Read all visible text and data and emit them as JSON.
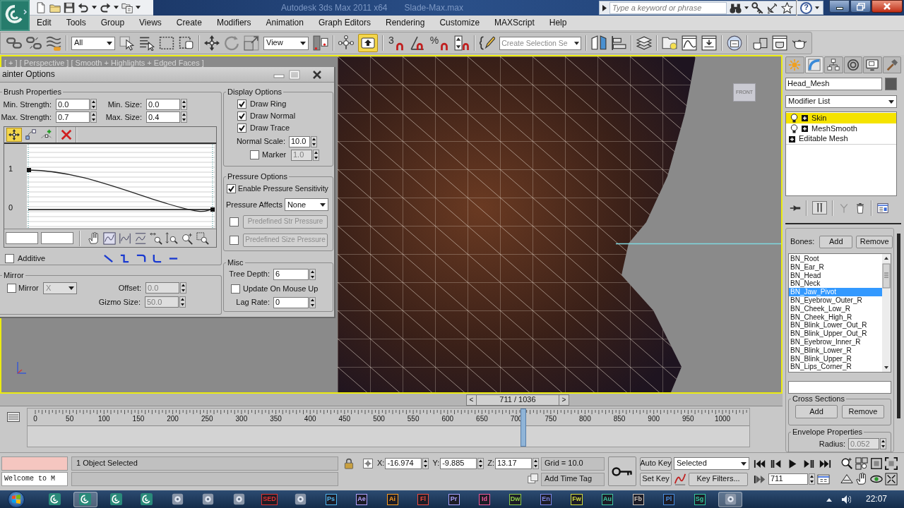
{
  "title_bar": {
    "app_title": "Autodesk 3ds Max 2011 x64",
    "file_name": "Slade-Max.max",
    "search": {
      "placeholder": "Type a keyword or phrase"
    },
    "help_label": "?"
  },
  "menu_bar": [
    "Edit",
    "Tools",
    "Group",
    "Views",
    "Create",
    "Modifiers",
    "Animation",
    "Graph Editors",
    "Rendering",
    "Customize",
    "MAXScript",
    "Help"
  ],
  "main_toolbar": [
    {
      "kind": "link",
      "selected": false
    },
    {
      "kind": "unlink",
      "selected": false
    },
    {
      "kind": "bind",
      "selected": false
    },
    {
      "kind": "dropdown",
      "value": "All"
    },
    {
      "kind": "select",
      "selected": false
    },
    {
      "kind": "select-by-name",
      "selected": false
    },
    {
      "kind": "region",
      "selected": false
    },
    {
      "kind": "crossing",
      "selected": false
    },
    {
      "kind": "move",
      "selected": false
    },
    {
      "kind": "rotate",
      "selected": false
    },
    {
      "kind": "scale",
      "selected": false
    },
    {
      "kind": "dropdown",
      "value": "View"
    },
    {
      "kind": "pivot",
      "selected": false
    },
    {
      "kind": "manipulate",
      "selected": false
    },
    {
      "kind": "override",
      "selected": true
    },
    {
      "kind": "snap",
      "label": "3",
      "selected": false
    },
    {
      "kind": "angle-snap",
      "selected": false
    },
    {
      "kind": "percent-snap",
      "label": "%",
      "selected": false
    },
    {
      "kind": "spinner-snap",
      "selected": false
    },
    {
      "kind": "edit-named",
      "selected": false
    },
    {
      "kind": "combo",
      "placeholder": "Create Selection Se"
    },
    {
      "kind": "mirror",
      "selected": false
    },
    {
      "kind": "align",
      "selected": false
    },
    {
      "kind": "layers",
      "selected": false
    },
    {
      "kind": "explorer",
      "selected": false
    },
    {
      "kind": "curve",
      "selected": false
    },
    {
      "kind": "schematic",
      "selected": false
    },
    {
      "kind": "material",
      "selected": false
    },
    {
      "kind": "render-setup",
      "selected": false
    },
    {
      "kind": "frame",
      "selected": false
    },
    {
      "kind": "render",
      "selected": false
    }
  ],
  "viewport": {
    "label": "[ + ] [ Perspective ] [ Smooth + Highlights + Edged Faces ]",
    "viewcube_label": "FRONT"
  },
  "painter_options": {
    "title": "ainter Options",
    "brush_properties": {
      "title": "Brush Properties",
      "fields": [
        {
          "label": "Min. Strength:",
          "value": "0.0",
          "disabled": false
        },
        {
          "label": "Min. Size:",
          "value": "0.0",
          "disabled": false
        },
        {
          "label": "Max. Strength:",
          "value": "0.7",
          "disabled": false
        },
        {
          "label": "Max. Size:",
          "value": "0.4",
          "disabled": false
        }
      ],
      "curve_tools": [
        {
          "kind": "move",
          "selected": true
        },
        {
          "kind": "scale",
          "selected": false
        },
        {
          "kind": "add",
          "selected": false
        },
        {
          "kind": "delete",
          "selected": false
        }
      ],
      "curve_labels": [
        "1",
        "0"
      ],
      "additive": {
        "label": "Additive",
        "checked": false
      }
    },
    "mirror": {
      "title": "Mirror",
      "enabled": {
        "label": "Mirror",
        "checked": false
      },
      "axis": {
        "value": "X",
        "disabled": true
      },
      "fields": [
        {
          "label": "Offset:",
          "value": "0.0",
          "disabled": true
        },
        {
          "label": "Gizmo Size:",
          "value": "50.0",
          "disabled": true
        }
      ]
    },
    "display_options": {
      "title": "Display Options",
      "checks": [
        {
          "label": "Draw Ring",
          "checked": true
        },
        {
          "label": "Draw Normal",
          "checked": true
        },
        {
          "label": "Draw Trace",
          "checked": true
        }
      ],
      "normal_scale": {
        "label": "Normal Scale:",
        "value": "10.0",
        "disabled": false
      },
      "marker": {
        "label": "Marker",
        "checked": false,
        "value": "1.0",
        "disabled": true
      }
    },
    "pressure_options": {
      "title": "Pressure Options",
      "enable": {
        "label": "Enable Pressure Sensitivity",
        "checked": true
      },
      "affects": {
        "label": "Pressure Affects",
        "value": "None"
      },
      "predefined": [
        {
          "label": "Predefined Str Pressure",
          "checked": false,
          "disabled": true
        },
        {
          "label": "Predefined Size Pressure",
          "checked": false,
          "disabled": true
        }
      ]
    },
    "misc": {
      "title": "Misc",
      "tree_depth": {
        "label": "Tree Depth:",
        "value": "6",
        "disabled": false
      },
      "update_on_mouse_up": {
        "label": "Update On Mouse Up",
        "checked": false
      },
      "lag_rate": {
        "label": "Lag Rate:",
        "value": "0",
        "disabled": false
      }
    }
  },
  "command_panel": {
    "tabs": [
      {
        "kind": "create",
        "selected": false
      },
      {
        "kind": "modify",
        "selected": true
      },
      {
        "kind": "hierarchy",
        "selected": false
      },
      {
        "kind": "motion",
        "selected": false
      },
      {
        "kind": "display",
        "selected": false
      },
      {
        "kind": "utilities",
        "selected": false
      }
    ],
    "object_name": "Head_Mesh",
    "modifier_list": "Modifier List",
    "stack": [
      {
        "name": "Skin",
        "kind": "modifier",
        "selected": true
      },
      {
        "name": "MeshSmooth",
        "kind": "modifier",
        "selected": false
      },
      {
        "name": "Editable Mesh",
        "kind": "base",
        "selected": false
      }
    ],
    "stack_tools": [
      {
        "kind": "pin",
        "on": false,
        "disabled": false
      },
      {
        "kind": "end-result",
        "on": true,
        "disabled": false
      },
      {
        "kind": "unique",
        "on": false,
        "disabled": true
      },
      {
        "kind": "remove",
        "on": false,
        "disabled": false
      },
      {
        "kind": "configure",
        "on": false,
        "disabled": false
      }
    ],
    "skin": {
      "bones_label": "Bones:",
      "add": "Add",
      "remove": "Remove",
      "bones": [
        {
          "name": "BN_Root",
          "selected": false
        },
        {
          "name": "BN_Ear_R",
          "selected": false
        },
        {
          "name": "BN_Head",
          "selected": false
        },
        {
          "name": "BN_Neck",
          "selected": false
        },
        {
          "name": "BN_Jaw_Pivot",
          "selected": true
        },
        {
          "name": "BN_Eyebrow_Outer_R",
          "selected": false
        },
        {
          "name": "BN_Cheek_Low_R",
          "selected": false
        },
        {
          "name": "BN_Cheek_High_R",
          "selected": false
        },
        {
          "name": "BN_Blink_Lower_Out_R",
          "selected": false
        },
        {
          "name": "BN_Blink_Upper_Out_R",
          "selected": false
        },
        {
          "name": "BN_Eyebrow_Inner_R",
          "selected": false
        },
        {
          "name": "BN_Blink_Lower_R",
          "selected": false
        },
        {
          "name": "BN_Blink_Upper_R",
          "selected": false
        },
        {
          "name": "BN_Lips_Corner_R",
          "selected": false
        }
      ],
      "cross_sections": {
        "title": "Cross Sections",
        "add": "Add",
        "remove": "Remove"
      },
      "envelope_properties": {
        "title": "Envelope Properties",
        "radius": {
          "label": "Radius:",
          "value": "0.052",
          "disabled": true
        }
      }
    }
  },
  "time_slider": {
    "prev": "<",
    "label": "711 / 1036",
    "next": ">"
  },
  "track_bar": {
    "ticks": [
      "0",
      "50",
      "100",
      "150",
      "200",
      "250",
      "300",
      "350",
      "400",
      "450",
      "500",
      "550",
      "600",
      "650",
      "700",
      "750",
      "800",
      "850",
      "900",
      "950",
      "1000"
    ],
    "playhead": {
      "level": 0.686
    }
  },
  "status_bar": {
    "listener_output": "Welcome to M",
    "prompt": "1 Object Selected",
    "coordinates": [
      {
        "axis": "X:",
        "value": "-16.974"
      },
      {
        "axis": "Y:",
        "value": "-9.885"
      },
      {
        "axis": "Z:",
        "value": "13.17"
      }
    ],
    "grid": "Grid = 10.0",
    "add_time_tag": "Add Time Tag",
    "auto_key": "Auto Key",
    "key_set": "Selected",
    "set_key": "Set Key",
    "key_filters": "Key Filters...",
    "current_frame": "711"
  },
  "taskbar": {
    "apps": [
      {
        "kind": "max",
        "active": false
      },
      {
        "kind": "max",
        "active": true
      },
      {
        "kind": "max",
        "active": false
      },
      {
        "kind": "max",
        "active": false
      },
      {
        "kind": "app",
        "active": false
      },
      {
        "kind": "app",
        "active": false
      },
      {
        "kind": "app",
        "active": false
      },
      {
        "kind": "tile",
        "label": "SED",
        "color": "#e03030",
        "active": false
      },
      {
        "kind": "app",
        "active": false
      },
      {
        "kind": "tile",
        "label": "Ps",
        "color": "#4fb5ef",
        "active": false
      },
      {
        "kind": "tile",
        "label": "Ae",
        "color": "#b3a2ff",
        "active": false
      },
      {
        "kind": "tile",
        "label": "Ai",
        "color": "#ff9d1f",
        "active": false
      },
      {
        "kind": "tile",
        "label": "Fl",
        "color": "#f04a3d",
        "active": false
      },
      {
        "kind": "tile",
        "label": "Pr",
        "color": "#a8a2ff",
        "active": false
      },
      {
        "kind": "tile",
        "label": "Id",
        "color": "#f0589a",
        "active": false
      },
      {
        "kind": "tile",
        "label": "Dw",
        "color": "#8ccc4a",
        "active": false
      },
      {
        "kind": "tile",
        "label": "En",
        "color": "#7c86e8",
        "active": false
      },
      {
        "kind": "tile",
        "label": "Fw",
        "color": "#d2dc3a",
        "active": false
      },
      {
        "kind": "tile",
        "label": "Au",
        "color": "#3fc8a0",
        "active": false
      },
      {
        "kind": "tile",
        "label": "Fb",
        "color": "#c8c0b8",
        "active": false
      },
      {
        "kind": "tile",
        "label": "Pl",
        "color": "#4a8ee0",
        "active": false
      },
      {
        "kind": "tile",
        "label": "Sg",
        "color": "#33c9a0",
        "active": false
      },
      {
        "kind": "app",
        "active": true
      }
    ],
    "clock": "22:07"
  }
}
